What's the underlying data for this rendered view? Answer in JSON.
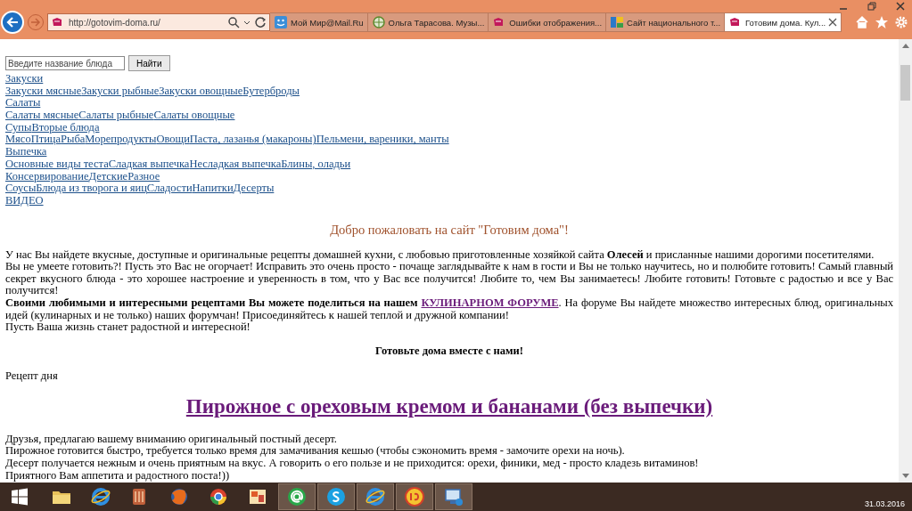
{
  "browser": {
    "address": "http://gotovim-doma.ru/",
    "tabs": [
      {
        "title": "Мой Мир@Mail.Ru",
        "selected": false
      },
      {
        "title": "Ольга Тарасова. Музы...",
        "selected": false
      },
      {
        "title": "Ошибки отображения...",
        "selected": false
      },
      {
        "title": "Сайт национального т...",
        "selected": false
      },
      {
        "title": "Готовим дома. Кул...",
        "selected": true
      }
    ]
  },
  "search": {
    "placeholder": "Введите название блюда",
    "button": "Найти"
  },
  "nav": [
    [
      "Закуски"
    ],
    [
      "Закуски мясные",
      "Закуски рыбные",
      "Закуски овощные",
      "Бутерброды"
    ],
    [
      "Салаты"
    ],
    [
      "Салаты мясные",
      "Салаты рыбные",
      "Салаты овощные"
    ],
    [
      "Супы",
      "Вторые блюда"
    ],
    [
      "Мясо",
      "Птица",
      "Рыба",
      "Морепродукты",
      "Овощи",
      "Паста, лазанья (макароны)",
      "Пельмени, вареники, манты"
    ],
    [
      "Выпечка"
    ],
    [
      "Основные виды теста",
      "Сладкая выпечка",
      "Несладкая выпечка",
      "Блины, оладьи"
    ],
    [
      "Консервирование",
      "Детские",
      "Разное"
    ],
    [
      "Соусы",
      "Блюда из творога и яиц",
      "Сладости",
      "Напитки",
      "Десерты"
    ],
    [
      "ВИДЕО"
    ]
  ],
  "welcome": "Добро пожаловать на сайт \"Готовим дома\"!",
  "intro": [
    {
      "text": "У нас Вы найдете вкусные, доступные и оригинальные рецепты домашней кухни, с любовью приготовленные хозяйкой сайта **Олесей** и присланные нашими дорогими посетителями."
    },
    {
      "text": "Вы не умеете готовить?! Пусть это Вас не огорчает! Исправить это очень просто - почаще заглядывайте к нам в гости и Вы не только научитесь, но и полюбите готовить! Самый главный секрет вкусного блюда - это хорошее настроение и уверенность в том, что у Вас все получится! Любите то, чем Вы занимаетесь! Любите готовить! Готовьте с радостью и все у Вас получится!"
    },
    {
      "text": "**Своими любимыми и интересными рецептами Вы можете поделиться на нашем** ",
      "link": "КУЛИНАРНОМ ФОРУМЕ",
      "after": ". На форуме Вы найдете множество интересных блюд, оригинальных идей (кулинарных и не только) наших форумчан! Присоединяйтесь к нашей теплой и дружной компании!"
    },
    {
      "text": "Пусть Ваша жизнь станет радостной и интересной!"
    }
  ],
  "motto": "Готовьте дома вместе с нами!",
  "recipe_label": "Рецепт дня",
  "recipe_title": "Пирожное с ореховым кремом и бананами (без выпечки)",
  "recipe_text": [
    "Друзья, предлагаю вашему вниманию оригинальный постный десерт.",
    "Пирожное готовится быстро, требуется только время для замачивания кешью (чтобы сэкономить время - замочите орехи на ночь).",
    "Десерт получается нежным и очень приятным на вкус. А говорить о его пользе и не приходится: орехи, финики, мед - просто кладезь витаминов!",
    "Приятного Вам аппетита и радостного поста!))"
  ],
  "taskbar": {
    "items": [
      {
        "kind": "folder",
        "active": false
      },
      {
        "kind": "browser",
        "active": false
      },
      {
        "kind": "media",
        "active": false
      },
      {
        "kind": "fox",
        "active": false
      },
      {
        "kind": "chrome",
        "active": false
      },
      {
        "kind": "photos",
        "active": false
      },
      {
        "kind": "mail",
        "active": true
      },
      {
        "kind": "chat",
        "active": true
      },
      {
        "kind": "browser",
        "active": true
      },
      {
        "kind": "accounting",
        "active": true
      },
      {
        "kind": "network",
        "active": true
      }
    ],
    "date": "31.03.2016"
  }
}
